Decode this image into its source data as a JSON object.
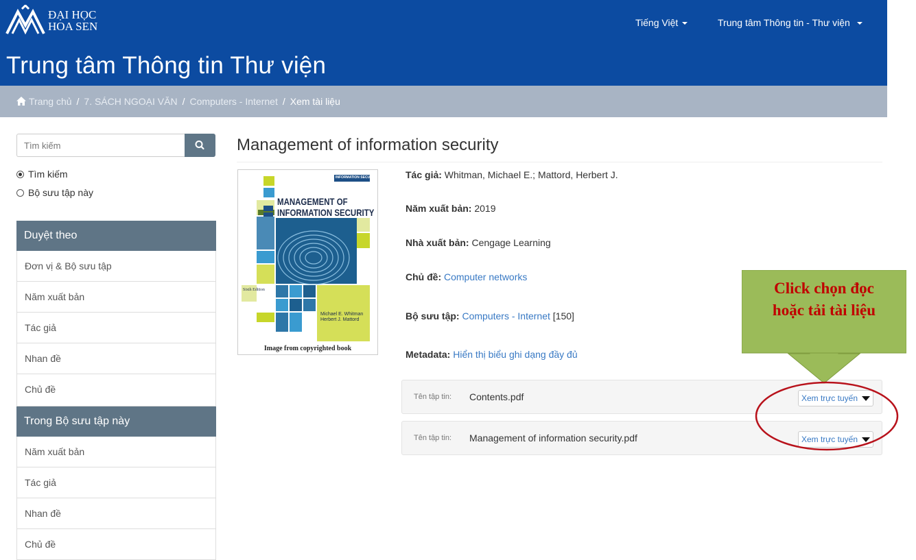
{
  "header": {
    "logo_line1": "ĐẠI HỌC",
    "logo_line2": "HOA SEN",
    "site_title": "Trung tâm Thông tin Thư viện",
    "language_menu": "Tiếng Việt",
    "center_menu": "Trung tâm Thông tin - Thư viện",
    "colors": {
      "bar": "#0c4ba1"
    }
  },
  "breadcrumb": {
    "icon": "home-icon",
    "items": [
      "Trang chủ",
      "7. SÁCH NGOẠI VĂN",
      "Computers - Internet"
    ],
    "current": "Xem tài liệu"
  },
  "sidebar": {
    "search_placeholder": "Tìm kiếm",
    "search_icon": "search-icon",
    "radio_options": [
      {
        "label": "Tìm kiếm",
        "selected": true
      },
      {
        "label": "Bộ sưu tập này",
        "selected": false
      }
    ],
    "browse_heading": "Duyệt theo",
    "browse_items": [
      "Đơn vị & Bộ sưu tập",
      "Năm xuất bản",
      "Tác giả",
      "Nhan đề",
      "Chủ đề"
    ],
    "collection_heading": "Trong Bộ sưu tập này",
    "collection_items": [
      "Năm xuất bản",
      "Tác giả",
      "Nhan đề",
      "Chủ đề"
    ]
  },
  "item": {
    "title": "Management of information security",
    "cover": {
      "series_tag": "INFORMATION SECURITY",
      "title_line1": "MANAGEMENT OF",
      "title_line2": "INFORMATION SECURITY",
      "edition": "Sixth Edition",
      "author1": "Michael E. Whitman",
      "author2": "Herbert J. Mattord",
      "caption": "Image from copyrighted book"
    },
    "fields": {
      "author_label": "Tác giả:",
      "author_value": "Whitman, Michael E.; Mattord, Herbert J.",
      "year_label": "Năm xuất bản:",
      "year_value": "2019",
      "publisher_label": "Nhà xuất bản:",
      "publisher_value": "Cengage Learning",
      "subject_label": "Chủ đề:",
      "subject_value": "Computer networks",
      "collection_label": "Bộ sưu tập:",
      "collection_value": "Computers - Internet",
      "collection_count": "[150]",
      "metadata_label": "Metadata:",
      "metadata_value": "Hiển thị biểu ghi dạng đầy đủ"
    },
    "files": [
      {
        "label": "Tên tập tin:",
        "name": "Contents.pdf",
        "action": "Xem trực tuyến"
      },
      {
        "label": "Tên tập tin:",
        "name": "Management of information security.pdf",
        "action": "Xem trực tuyến"
      }
    ]
  },
  "annotation": {
    "line1": "Click chọn đọc",
    "line2": "hoặc tải tài liệu",
    "colors": {
      "box": "#9bbb59",
      "text": "#c00000",
      "ellipse": "#b8121b"
    }
  }
}
